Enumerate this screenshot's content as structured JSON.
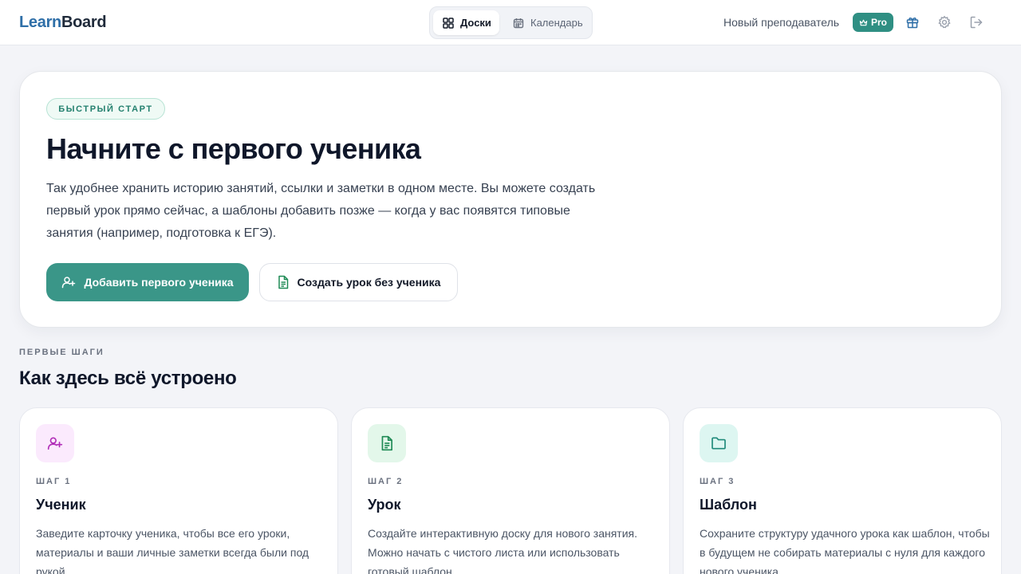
{
  "header": {
    "logo_part1": "Learn",
    "logo_part2": "Board",
    "tabs": [
      {
        "label": "Доски",
        "icon": "grid-icon",
        "active": true
      },
      {
        "label": "Календарь",
        "icon": "calendar-icon",
        "active": false
      }
    ],
    "user_name": "Новый преподаватель",
    "badge": "Pro",
    "icons": [
      "gift-icon",
      "gear-icon",
      "logout-icon"
    ]
  },
  "hero": {
    "tag": "БЫСТРЫЙ СТАРТ",
    "title": "Начните с первого ученика",
    "text": "Так удобнее хранить историю занятий, ссылки и заметки в одном месте. Вы можете создать первый урок прямо сейчас, а шаблоны добавить позже — когда у вас появятся типовые занятия (например, подготовка к ЕГЭ).",
    "primary_button": "Добавить первого ученика",
    "secondary_button": "Создать урок без ученика"
  },
  "steps_section": {
    "label": "ПЕРВЫЕ ШАГИ",
    "title": "Как здесь всё устроено",
    "cards": [
      {
        "step": "ШАГ 1",
        "title": "Ученик",
        "text": "Заведите карточку ученика, чтобы все его уроки, материалы и ваши личные заметки всегда были под рукой.",
        "icon": "user-plus-icon",
        "icon_bg": "#fbeafd",
        "icon_color": "#b12fb8"
      },
      {
        "step": "ШАГ 2",
        "title": "Урок",
        "text": "Создайте интерактивную доску для нового занятия. Можно начать с чистого листа или использовать готовый шаблон.",
        "icon": "document-icon",
        "icon_bg": "#e3f7ea",
        "icon_color": "#1f8a55"
      },
      {
        "step": "ШАГ 3",
        "title": "Шаблон",
        "text": "Сохраните структуру удачного урока как шаблон, чтобы в будущем не собирать материалы с нуля для каждого нового ученика.",
        "icon": "folder-icon",
        "icon_bg": "#ddf6f1",
        "icon_color": "#1f8a7a"
      }
    ]
  },
  "colors": {
    "accent": "#3a9688",
    "background": "#f3f4f8"
  }
}
